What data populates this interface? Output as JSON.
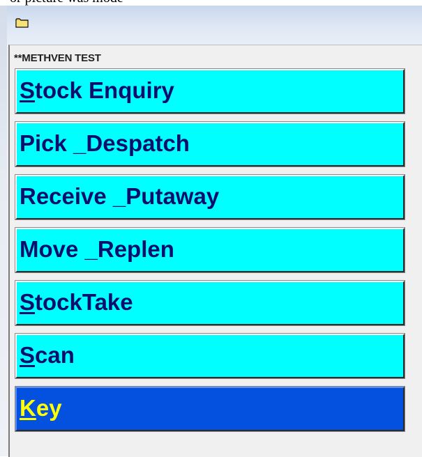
{
  "window": {
    "partial_caption": "or picture was mode",
    "icon": "folder-icon"
  },
  "form": {
    "heading": "**METHVEN TEST"
  },
  "menu": {
    "items": [
      {
        "mnemonic": "S",
        "rest": "tock Enquiry",
        "selected": false
      },
      {
        "mnemonic": "",
        "rest": "Pick _Despatch",
        "selected": false
      },
      {
        "mnemonic": "",
        "rest": "Receive _Putaway",
        "selected": false
      },
      {
        "mnemonic": "",
        "rest": "Move _Replen",
        "selected": false
      },
      {
        "mnemonic": "S",
        "rest": "tockTake",
        "selected": false
      },
      {
        "mnemonic": "S",
        "rest": "can",
        "selected": false
      },
      {
        "mnemonic": "K",
        "rest": "ey",
        "selected": true
      }
    ]
  },
  "colors": {
    "button_face": "#00ffff",
    "button_text": "#0a0f6e",
    "selected_face": "#0451e0",
    "selected_text": "#ffff00"
  }
}
